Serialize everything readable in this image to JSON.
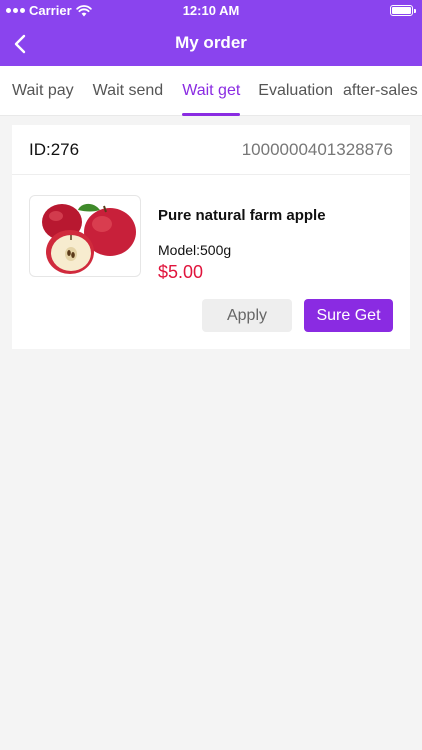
{
  "status_bar": {
    "carrier": "Carrier",
    "time": "12:10 AM"
  },
  "nav": {
    "title": "My order",
    "back_icon": "chevron-left-icon"
  },
  "tabs": [
    {
      "label": "Wait pay",
      "active": false
    },
    {
      "label": "Wait send",
      "active": false
    },
    {
      "label": "Wait get",
      "active": true
    },
    {
      "label": "Evaluation",
      "active": false
    },
    {
      "label": "after-sales",
      "active": false
    }
  ],
  "order": {
    "id_label": "ID:276",
    "order_number": "1000000401328876",
    "product": {
      "name": "Pure natural farm apple",
      "model": "Model:500g",
      "price": "$5.00",
      "image_icon": "apple-product-image"
    },
    "buttons": {
      "apply": "Apply",
      "sure_get": "Sure Get"
    }
  },
  "colors": {
    "header": "#8a44ee",
    "accent": "#8a2be2",
    "price": "#e0143c",
    "background": "#f4f4f4"
  }
}
